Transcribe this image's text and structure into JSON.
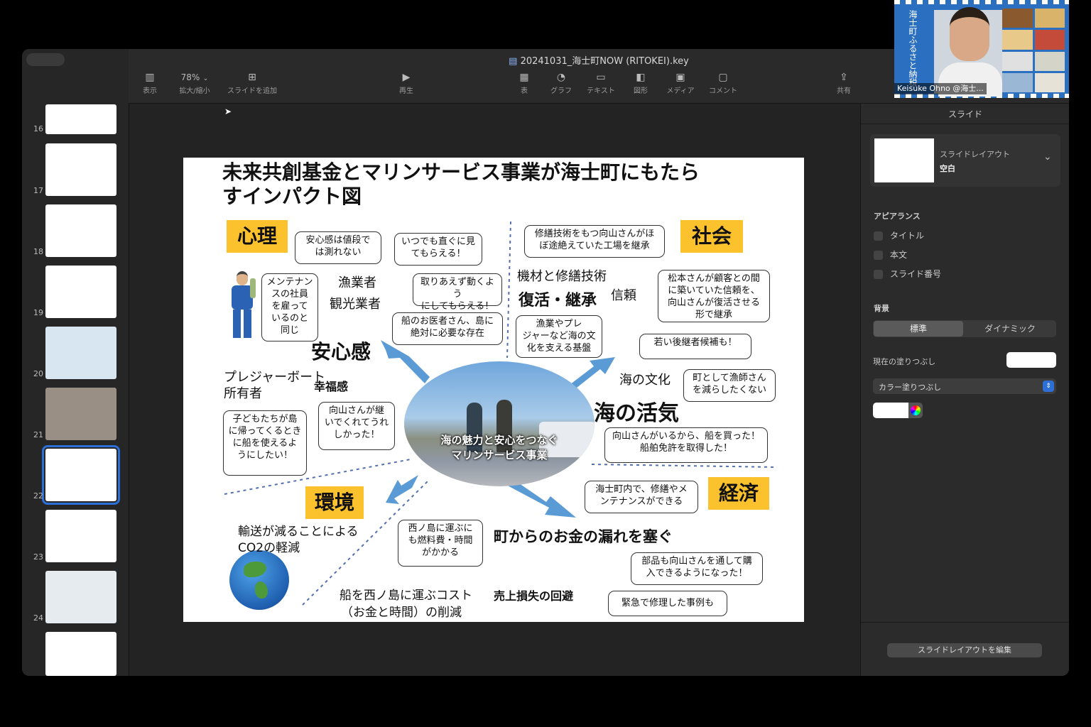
{
  "window_title": "20241031_海士町NOW (RITOKEI).key",
  "toolbar": {
    "view_label": "表示",
    "zoom_value": "78%",
    "zoom_label": "拡大/縮小",
    "add_slide_label": "スライドを追加",
    "play_label": "再生",
    "table_label": "表",
    "chart_label": "グラフ",
    "text_label": "テキスト",
    "shape_label": "図形",
    "media_label": "メディア",
    "comment_label": "コメント",
    "share_label": "共有"
  },
  "sidebar": {
    "slides": [
      {
        "num": "16"
      },
      {
        "num": "17"
      },
      {
        "num": "18"
      },
      {
        "num": "19"
      },
      {
        "num": "20"
      },
      {
        "num": "21"
      },
      {
        "num": "22"
      },
      {
        "num": "23"
      },
      {
        "num": "24"
      }
    ],
    "selected": "22"
  },
  "video": {
    "name": "Keisuke Ohno @海士...",
    "banner_text": "海士町ふるさと納税"
  },
  "slide": {
    "title_line1": "未来共創基金とマリンサービス事業が海士町にもたら",
    "title_line2": "すインパクト図",
    "cat_psych": "心理",
    "cat_social": "社会",
    "cat_env": "環境",
    "cat_econ": "経済",
    "center_text_1": "海の魅力と安心をつなぐ",
    "center_text_2": "マリンサービス事業",
    "labels": {
      "fisher": "漁業者",
      "tourism": "観光業者",
      "anshin": "安心感",
      "pleasure1": "プレジャーボート",
      "pleasure2": "所有者",
      "happiness": "幸福感",
      "equipment": "機材と修繕技術",
      "revival": "復活・継承",
      "trust": "信頼",
      "sea_culture": "海の文化",
      "sea_vitality": "海の活気",
      "transport1": "輸送が減ることによる",
      "transport2": "CO2の軽減",
      "cost1": "船を西ノ島に運ぶコスト",
      "cost2": "（お金と時間）の削減",
      "leak": "町からのお金の漏れを塞ぐ",
      "loss": "売上損失の回避"
    },
    "bubbles": {
      "b1": "安心感は値段で\nは測れない",
      "b2": "いつでも直ぐに見\nてもらえる！",
      "b3": "メンテナン\nスの社員\nを雇って\nいるのと\n同じ",
      "b4": "取りあえず動くよう\nにしてもらえる！",
      "b5": "船のお医者さん、島に\n絶対に必要な存在",
      "b6": "修繕技術をもつ向山さんがほ\nぼ途絶えていた工場を継承",
      "b7": "松本さんが顧客との間\nに築いていた信頼を、\n向山さんが復活させる\n形で継承",
      "b8": "漁業やプレ\nジャーなど海の文\n化を支える基盤",
      "b9": "若い後継者候補も！",
      "b10": "町として漁師さん\nを減らしたくない",
      "b11": "子どもたちが島\nに帰ってくるとき\nに船を使えるよ\nうにしたい！",
      "b12": "向山さんが継\nいでくれてうれ\nしかった！",
      "b13": "向山さんがいるから、船を買った！\n船舶免許を取得した！",
      "b14": "海士町内で、修繕やメ\nンテナンスができる",
      "b15": "西ノ島に運ぶに\nも燃料費・時間\nがかかる",
      "b16": "部品も向山さんを通して購\n入できるようになった！",
      "b17": "緊急で修理した事例も"
    }
  },
  "inspector": {
    "tab_label": "スライド",
    "layout_title": "スライドレイアウト",
    "layout_value": "空白",
    "appearance_label": "アピアランス",
    "check_title": "タイトル",
    "check_body": "本文",
    "check_number": "スライド番号",
    "background_label": "背景",
    "seg_standard": "標準",
    "seg_dynamic": "ダイナミック",
    "fill_label": "現在の塗りつぶし",
    "fill_type": "カラー塗りつぶし",
    "edit_layout_button": "スライドレイアウトを編集"
  },
  "colors": {
    "accent_yellow": "#fcc22e",
    "arrow_blue": "#5b9bd5",
    "selection_blue": "#2d6fd6"
  }
}
